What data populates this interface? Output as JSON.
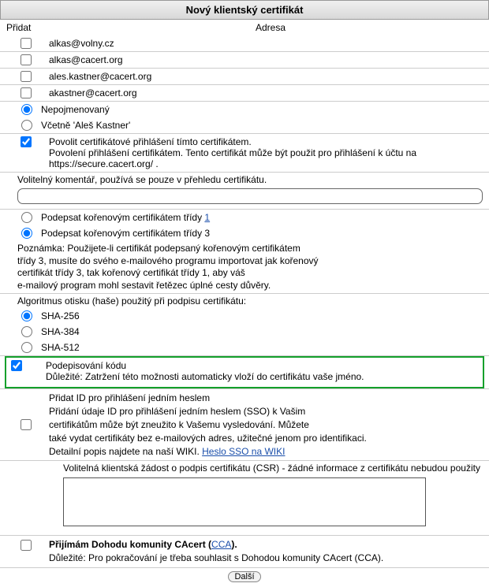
{
  "title": "Nový klientský certifikát",
  "headers": {
    "add": "Přidat",
    "address": "Adresa"
  },
  "emails": [
    "alkas@volny.cz",
    "alkas@cacert.org",
    "ales.kastner@cacert.org",
    "akastner@cacert.org"
  ],
  "nameOptions": {
    "unnamed": "Nepojmenovaný",
    "includingName": "Včetně 'Aleš Kastner'"
  },
  "allowLogin": {
    "line1": "Povolit certifikátové přihlášení tímto certifikátem.",
    "line2": "Povolení přihlášení certifikátem. Tento certifikát může být použit pro přihlášení k účtu na https://secure.cacert.org/ ."
  },
  "commentLabel": "Volitelný komentář, používá se pouze v přehledu certifikátu.",
  "signing": {
    "class1a": "Podepsat kořenovým certifikátem třídy ",
    "class1b": "1",
    "class3": "Podepsat kořenovým certifikátem třídy 3",
    "note1": "Poznámka: Použijete-li certifikát podepsaný kořenovým certifikátem",
    "note2": "třídy 3, musíte do svého e-mailového programu importovat jak kořenový",
    "note3": "certifikát třídy 3, tak kořenový certifikát třídy 1, aby váš",
    "note4": "e-mailový program mohl sestavit řetězec úplné cesty důvěry."
  },
  "hashLabel": "Algoritmus otisku (haše) použitý při podpisu certifikátu:",
  "hash": {
    "sha256": "SHA-256",
    "sha384": "SHA-384",
    "sha512": "SHA-512"
  },
  "codesign": {
    "line1": "Podepisování kódu",
    "line2": "Důležité: Zatržení této možnosti automaticky vloží do certifikátu vaše jméno."
  },
  "sso": {
    "line1": "Přidat ID pro přihlášení jedním heslem",
    "line2": "Přidání údaje ID pro přihlášení jedním heslem (SSO) k Vašim",
    "line3": "certifikátům může být zneužito k Vašemu vysledování. Můžete",
    "line4": "také vydat certifikáty bez e-mailových adres, užitečné jenom pro identifikaci.",
    "line5a": "Detailní popis najdete na naší WIKI. ",
    "line5link": "Heslo SSO na WIKI"
  },
  "csrLabel": "Volitelná klientská žádost o podpis certifikátu (CSR) - žádné informace z certifikátu nebudou použity",
  "agree": {
    "line1a": "Přijímám Dohodu komunity CAcert (",
    "line1link": "CCA",
    "line1b": ").",
    "line2": "Důležité: Pro pokračování je třeba souhlasit s Dohodou komunity CAcert (CCA)."
  },
  "submit": "Další"
}
